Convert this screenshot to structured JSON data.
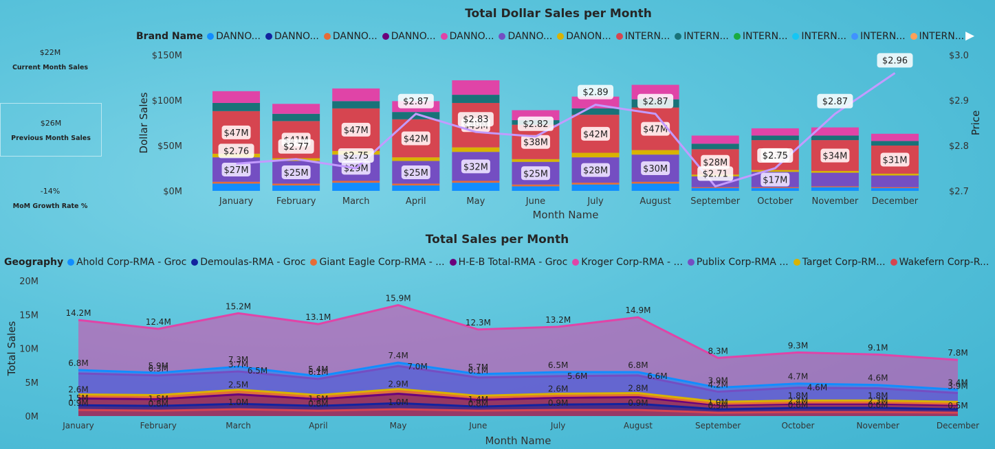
{
  "kpis": [
    {
      "value": "$22M",
      "label": "Current Month Sales"
    },
    {
      "value": "$26M",
      "label": "Previous Month Sales"
    },
    {
      "value": "-14%",
      "label": "MoM Growth Rate %"
    }
  ],
  "chart1": {
    "title": "Total Dollar Sales per Month",
    "legend_title": "Brand Name",
    "legend_items": [
      {
        "name": "DANNO...",
        "color": "#118dff"
      },
      {
        "name": "DANNO...",
        "color": "#12239e"
      },
      {
        "name": "DANNO...",
        "color": "#e66c37"
      },
      {
        "name": "DANNO...",
        "color": "#6b007b"
      },
      {
        "name": "DANNO...",
        "color": "#e044a7"
      },
      {
        "name": "DANNO...",
        "color": "#744ec2"
      },
      {
        "name": "DANON...",
        "color": "#d9b300"
      },
      {
        "name": "INTERN...",
        "color": "#d64550"
      },
      {
        "name": "INTERN...",
        "color": "#197278"
      },
      {
        "name": "INTERN...",
        "color": "#1aab40"
      },
      {
        "name": "INTERN...",
        "color": "#15c6f4"
      },
      {
        "name": "INTERN...",
        "color": "#4092ff"
      },
      {
        "name": "INTERN...",
        "color": "#ffa058"
      }
    ],
    "arrow": "▶"
  },
  "chart2": {
    "title": "Total Sales per Month",
    "legend_title": "Geography",
    "legend_items": [
      {
        "name": "Ahold Corp-RMA - Groc",
        "color": "#118dff"
      },
      {
        "name": "Demoulas-RMA - Groc",
        "color": "#12239e"
      },
      {
        "name": "Giant Eagle Corp-RMA - ...",
        "color": "#e66c37"
      },
      {
        "name": "H-E-B Total-RMA - Groc",
        "color": "#6b007b"
      },
      {
        "name": "Kroger Corp-RMA - ...",
        "color": "#e044a7"
      },
      {
        "name": "Publix Corp-RMA ...",
        "color": "#744ec2"
      },
      {
        "name": "Target Corp-RM...",
        "color": "#d9b300"
      },
      {
        "name": "Wakefern Corp-R...",
        "color": "#d64550"
      }
    ]
  },
  "chart_data": [
    {
      "type": "bar",
      "stacked": true,
      "title": "Total Dollar Sales per Month",
      "xlabel": "Month Name",
      "ylabel": "Dollar Sales",
      "y2label": "Price",
      "ylim": [
        0,
        150
      ],
      "y2lim": [
        2.7,
        3.0
      ],
      "yticks": [
        "$0M",
        "$50M",
        "$100M",
        "$150M"
      ],
      "y2ticks": [
        "$2.7",
        "$2.8",
        "$2.9",
        "$3.0"
      ],
      "categories": [
        "January",
        "February",
        "March",
        "April",
        "May",
        "June",
        "July",
        "August",
        "September",
        "October",
        "November",
        "December"
      ],
      "series": [
        {
          "color": "#118dff",
          "values": [
            8,
            6,
            9,
            6,
            9,
            5,
            7,
            8,
            3,
            3,
            4,
            3
          ]
        },
        {
          "color": "#e66c37",
          "values": [
            2,
            2,
            2,
            2,
            2,
            2,
            2,
            2,
            1,
            1,
            1,
            1
          ]
        },
        {
          "color": "#744ec2",
          "values": [
            27,
            25,
            29,
            25,
            32,
            25,
            28,
            30,
            12,
            17,
            15,
            13
          ]
        },
        {
          "color": "#d9b300",
          "values": [
            4,
            3,
            4,
            4,
            5,
            3,
            5,
            5,
            2,
            2,
            2,
            2
          ]
        },
        {
          "color": "#d64550",
          "values": [
            47,
            41,
            47,
            42,
            49,
            38,
            42,
            47,
            28,
            33,
            34,
            31
          ]
        },
        {
          "color": "#197278",
          "values": [
            9,
            8,
            8,
            8,
            9,
            5,
            7,
            9,
            6,
            5,
            5,
            5
          ]
        },
        {
          "color": "#e044a7",
          "values": [
            13,
            11,
            14,
            12,
            16,
            11,
            13,
            16,
            9,
            8,
            9,
            8
          ]
        }
      ],
      "labels": [
        {
          "series": 2,
          "texts": [
            "$27M",
            "$25M",
            "$29M",
            "$25M",
            "$32M",
            "$25M",
            "$28M",
            "$30M",
            "",
            "$17M",
            "",
            ""
          ]
        },
        {
          "series": 4,
          "texts": [
            "$47M",
            "$41M",
            "$47M",
            "$42M",
            "$49M",
            "$38M",
            "$42M",
            "$47M",
            "$28M",
            "$33M",
            "$34M",
            "$31M"
          ]
        }
      ],
      "line": {
        "name": "Price",
        "color": "#c39bff",
        "values": [
          2.76,
          2.77,
          2.75,
          2.87,
          2.83,
          2.82,
          2.89,
          2.87,
          2.71,
          2.75,
          2.87,
          2.96
        ],
        "labels": [
          "$2.76",
          "$2.77",
          "$2.75",
          "$2.87",
          "$2.83",
          "$2.82",
          "$2.89",
          "$2.87",
          "$2.71",
          "$2.75",
          "$2.87",
          "$2.96"
        ]
      }
    },
    {
      "type": "area",
      "stacked": true,
      "title": "Total Sales per Month",
      "xlabel": "Month Name",
      "ylabel": "Total Sales",
      "ylim": [
        0,
        20
      ],
      "yticks": [
        "0M",
        "5M",
        "10M",
        "15M",
        "20M"
      ],
      "categories": [
        "January",
        "February",
        "March",
        "April",
        "May",
        "June",
        "July",
        "August",
        "September",
        "October",
        "November",
        "December"
      ],
      "series": [
        {
          "color": "#d64550",
          "values": [
            0.9,
            0.8,
            1.0,
            0.8,
            1.0,
            0.8,
            0.9,
            0.9,
            0.5,
            0.6,
            0.6,
            0.5
          ],
          "labels": [
            "0.9M",
            "0.8M",
            "1.0M",
            "0.8M",
            "1.0M",
            "0.8M",
            "0.9M",
            "0.9M",
            "0.5M",
            "0.6M",
            "0.6M",
            "0.5M"
          ]
        },
        {
          "color": "#12239e",
          "values": [
            0.7,
            0.7,
            0.8,
            0.7,
            0.9,
            0.6,
            0.8,
            0.9,
            0.5,
            0.6,
            0.6,
            0.5
          ],
          "labels": [
            "1.5M",
            "1.5M",
            "",
            "1.5M",
            "",
            "1.4M",
            "",
            "",
            "1.0M",
            "2.4M",
            "2.3M",
            ""
          ]
        },
        {
          "color": "#6b007b",
          "values": [
            1.0,
            1.0,
            1.4,
            1.0,
            1.4,
            1.0,
            1.0,
            1.0,
            0.6,
            0.6,
            0.6,
            0.6
          ],
          "labels": [
            "",
            "",
            "",
            "",
            "",
            "",
            "",
            "",
            "",
            "",
            "",
            ""
          ]
        },
        {
          "color": "#e66c37",
          "values": [
            0.3,
            0.3,
            0.4,
            0.3,
            0.4,
            0.3,
            0.3,
            0.3,
            0.2,
            0.2,
            0.2,
            0.2
          ],
          "labels": [
            "2.6M",
            "",
            "2.5M",
            "",
            "2.9M",
            "",
            "2.6M",
            "2.8M",
            "",
            "1.8M",
            "1.8M",
            ""
          ]
        },
        {
          "color": "#d9b300",
          "values": [
            0.3,
            0.3,
            0.3,
            0.3,
            0.3,
            0.3,
            0.3,
            0.3,
            0.3,
            0.3,
            0.3,
            0.3
          ],
          "labels": [
            "",
            "",
            "",
            "",
            "",
            "",
            "",
            "",
            "",
            "",
            "",
            ""
          ]
        },
        {
          "color": "#744ec2",
          "values": [
            3.1,
            2.9,
            2.7,
            2.4,
            3.4,
            2.7,
            2.6,
            2.6,
            1.5,
            1.9,
            1.8,
            1.3
          ],
          "labels": [
            "",
            "6.3M",
            "3.7M",
            "6.1M",
            "",
            "6.1M",
            "",
            "",
            "4.2M",
            "",
            "",
            "3.9M"
          ]
        },
        {
          "color": "#118dff",
          "values": [
            0.5,
            0.4,
            0.7,
            0.4,
            0.5,
            0.5,
            0.6,
            0.5,
            0.6,
            0.6,
            0.5,
            0.5
          ],
          "labels": [
            "6.8M",
            "5.9M",
            "7.3M",
            "5.4M",
            "7.4M",
            "5.7M",
            "6.5M",
            "6.8M",
            "3.9M",
            "4.7M",
            "4.6M",
            "3.4M"
          ]
        },
        {
          "color": "#e044a7",
          "values": [
            7.4,
            6.5,
            7.9,
            7.7,
            8.5,
            6.6,
            6.7,
            8.1,
            4.4,
            4.6,
            4.5,
            4.4
          ],
          "labels": [
            "14.2M",
            "12.4M",
            "15.2M",
            "13.1M",
            "15.9M",
            "12.3M",
            "13.2M",
            "14.9M",
            "8.3M",
            "9.3M",
            "9.1M",
            "7.8M"
          ]
        }
      ],
      "extra_labels": [
        {
          "x": "March",
          "text": "6.5M"
        },
        {
          "x": "May",
          "text": "7.0M"
        },
        {
          "x": "July",
          "text": "5.6M"
        },
        {
          "x": "August",
          "text": "6.6M"
        },
        {
          "x": "October",
          "text": "4.6M"
        }
      ]
    }
  ]
}
